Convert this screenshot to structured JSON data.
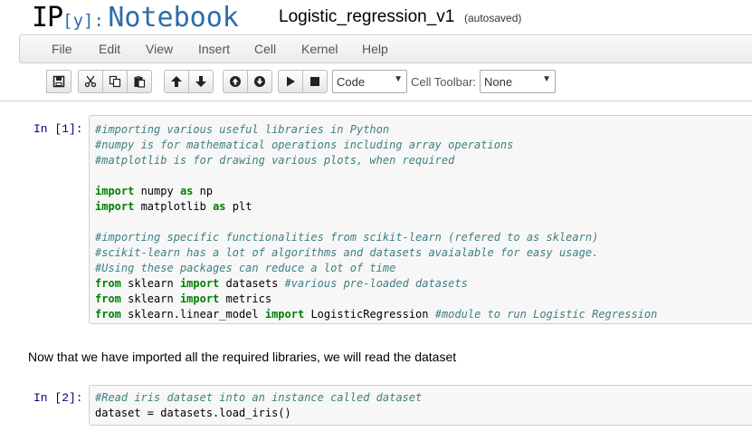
{
  "header": {
    "logo_ip": "IP",
    "logo_y": "[y]:",
    "logo_notebook": "Notebook",
    "notebook_name": "Logistic_regression_v1",
    "autosave_status": "(autosaved)"
  },
  "menu": {
    "file": "File",
    "edit": "Edit",
    "view": "View",
    "insert": "Insert",
    "cell": "Cell",
    "kernel": "Kernel",
    "help": "Help"
  },
  "toolbar": {
    "icons": [
      "save-icon",
      "cut-icon",
      "copy-icon",
      "paste-icon",
      "move-up-icon",
      "move-down-icon",
      "run-above-icon",
      "run-below-icon",
      "play-icon",
      "stop-icon"
    ],
    "cell_type_value": "Code",
    "cell_toolbar_label": "Cell Toolbar:",
    "cell_toolbar_value": "None"
  },
  "cells": [
    {
      "prompt": "In [1]:",
      "lines": [
        [
          {
            "t": "#importing various useful libraries in Python",
            "s": "c"
          }
        ],
        [
          {
            "t": "#numpy is for mathematical operations including array operations",
            "s": "c"
          }
        ],
        [
          {
            "t": "#matplotlib is for drawing various plots, when required",
            "s": "c"
          }
        ],
        [],
        [
          {
            "t": "import",
            "s": "k"
          },
          {
            "t": " numpy ",
            "s": ""
          },
          {
            "t": "as",
            "s": "k"
          },
          {
            "t": " np",
            "s": ""
          }
        ],
        [
          {
            "t": "import",
            "s": "k"
          },
          {
            "t": " matplotlib ",
            "s": ""
          },
          {
            "t": "as",
            "s": "k"
          },
          {
            "t": " plt",
            "s": ""
          }
        ],
        [],
        [
          {
            "t": "#importing specific functionalities from scikit-learn (refered to as sklearn)",
            "s": "c"
          }
        ],
        [
          {
            "t": "#scikit-learn has a lot of algorithms and datasets avaialable for easy usage.",
            "s": "c"
          }
        ],
        [
          {
            "t": "#Using these packages can reduce a lot of time",
            "s": "c"
          }
        ],
        [
          {
            "t": "from",
            "s": "k"
          },
          {
            "t": " sklearn ",
            "s": ""
          },
          {
            "t": "import",
            "s": "k"
          },
          {
            "t": " datasets ",
            "s": ""
          },
          {
            "t": "#various pre-loaded datasets",
            "s": "c"
          }
        ],
        [
          {
            "t": "from",
            "s": "k"
          },
          {
            "t": " sklearn ",
            "s": ""
          },
          {
            "t": "import",
            "s": "k"
          },
          {
            "t": " metrics",
            "s": ""
          }
        ],
        [
          {
            "t": "from",
            "s": "k"
          },
          {
            "t": " sklearn.linear_model ",
            "s": ""
          },
          {
            "t": "import",
            "s": "k"
          },
          {
            "t": " LogisticRegression ",
            "s": ""
          },
          {
            "t": "#module to run Logistic Regression",
            "s": "c"
          }
        ]
      ]
    },
    {
      "prompt": "In [2]:",
      "lines": [
        [
          {
            "t": "#Read iris dataset into an instance called dataset",
            "s": "c"
          }
        ],
        [
          {
            "t": "dataset = datasets.load_iris()",
            "s": ""
          }
        ]
      ]
    }
  ],
  "markdown": {
    "text": "Now that we have imported all the required libraries, we will read the dataset"
  }
}
